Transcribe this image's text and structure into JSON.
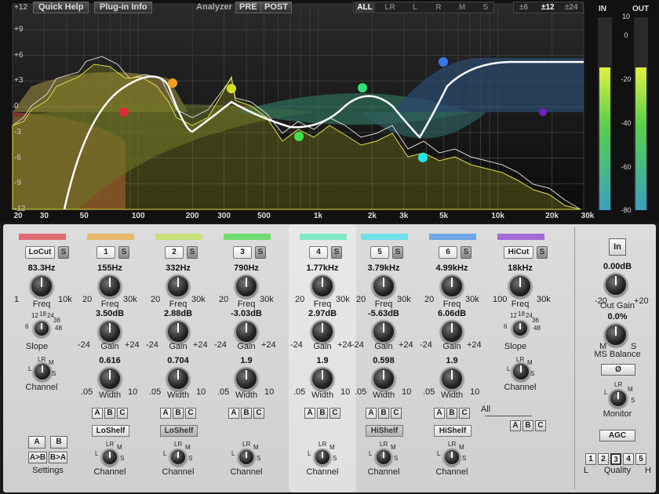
{
  "toolbar": {
    "quick_help": "Quick Help",
    "plugin_info": "Plug-in Info",
    "analyzer_label": "Analyzer",
    "pre": "PRE",
    "post": "POST",
    "channels": [
      "ALL",
      "LR",
      "L",
      "R",
      "M",
      "S"
    ],
    "ranges": [
      "±6",
      "±12",
      "±24"
    ],
    "selected_channel": "ALL",
    "selected_range": "±12"
  },
  "y_axis": [
    "+12",
    "+9",
    "+6",
    "+3",
    "0",
    "-3",
    "-6",
    "-9",
    "-12"
  ],
  "x_axis": [
    "20",
    "30",
    "50",
    "100",
    "200",
    "300",
    "500",
    "1k",
    "2k",
    "3k",
    "5k",
    "10k",
    "20k",
    "30k"
  ],
  "meters": {
    "in_label": "IN",
    "out_label": "OUT",
    "ticks": [
      "0",
      "-20",
      "-40",
      "-60",
      "-80"
    ],
    "top_tick": "10"
  },
  "bands": [
    {
      "name": "LoCut",
      "color": "#e06b73",
      "freq": "83.3Hz",
      "freq_min": "1",
      "freq_max": "10k",
      "slope_label": "Slope",
      "slope_ticks": [
        "12",
        "18",
        "24",
        "36",
        "6",
        "48"
      ],
      "channel_label": "Channel"
    },
    {
      "name": "1",
      "color": "#e8b86a",
      "freq": "155Hz",
      "gain": "3.50dB",
      "width": "0.616",
      "shape": "LoShelf",
      "shape_active": true
    },
    {
      "name": "2",
      "color": "#c8e27a",
      "freq": "332Hz",
      "gain": "2.88dB",
      "width": "0.704",
      "shape": "LoShelf",
      "shape_active": false
    },
    {
      "name": "3",
      "color": "#6fdc6f",
      "freq": "790Hz",
      "gain": "-3.03dB",
      "width": "1.9",
      "shape": ""
    },
    {
      "name": "4",
      "color": "#7fe8c2",
      "freq": "1.77kHz",
      "gain": "2.97dB",
      "width": "1.9",
      "shape": ""
    },
    {
      "name": "5",
      "color": "#6fdfe6",
      "freq": "3.79kHz",
      "gain": "-5.63dB",
      "width": "0.598",
      "shape": "HiShelf",
      "shape_active": false
    },
    {
      "name": "6",
      "color": "#6fa6e6",
      "freq": "4.99kHz",
      "gain": "6.06dB",
      "width": "1.9",
      "shape": "HiShelf",
      "shape_active": true
    },
    {
      "name": "HiCut",
      "color": "#a46ad8",
      "freq": "18kHz",
      "freq_min": "100",
      "freq_max": "30k",
      "slope_label": "Slope",
      "slope_ticks": [
        "12",
        "18",
        "24",
        "36",
        "6",
        "48"
      ],
      "channel_label": "Channel"
    }
  ],
  "labels": {
    "freq": "Freq",
    "gain": "Gain",
    "width": "Width",
    "channel": "Channel",
    "freq_min": "20",
    "freq_max": "30k",
    "gain_min": "-24",
    "gain_max": "+24",
    "width_min": ".05",
    "width_max": "10",
    "chan_l": "L",
    "chan_lr": "LR",
    "chan_m": "M",
    "chan_s": "S",
    "chan_r": "R",
    "a": "A",
    "b": "B",
    "c": "C",
    "all": "All"
  },
  "settings": {
    "a": "A",
    "b": "B",
    "a_to_b": "A>B",
    "b_to_a": "B>A",
    "label": "Settings"
  },
  "right": {
    "in_button": "In",
    "out_gain": "0.00dB",
    "out_gain_label": "Out Gain",
    "out_gain_min": "-20",
    "out_gain_max": "+20",
    "ms_balance": "0.0%",
    "ms_balance_label": "MS Balance",
    "ms_min": "M",
    "ms_max": "S",
    "phase_button": "Ø",
    "monitor_label": "Monitor",
    "agc": "AGC",
    "quality": [
      "1",
      "2",
      "3",
      "4",
      "5"
    ],
    "quality_selected": "3",
    "quality_label": "Quality",
    "quality_low": "L",
    "quality_high": "H"
  },
  "colors": {
    "accent_curve": "#ffffff",
    "point_orange": "#f0a020",
    "point_red": "#e02a3a",
    "point_yellow": "#d6e020",
    "point_green1": "#40e04a",
    "point_green2": "#30e070",
    "point_cyan": "#20e8e8",
    "point_blue": "#3a7ae8",
    "point_purple": "#7020c0"
  }
}
